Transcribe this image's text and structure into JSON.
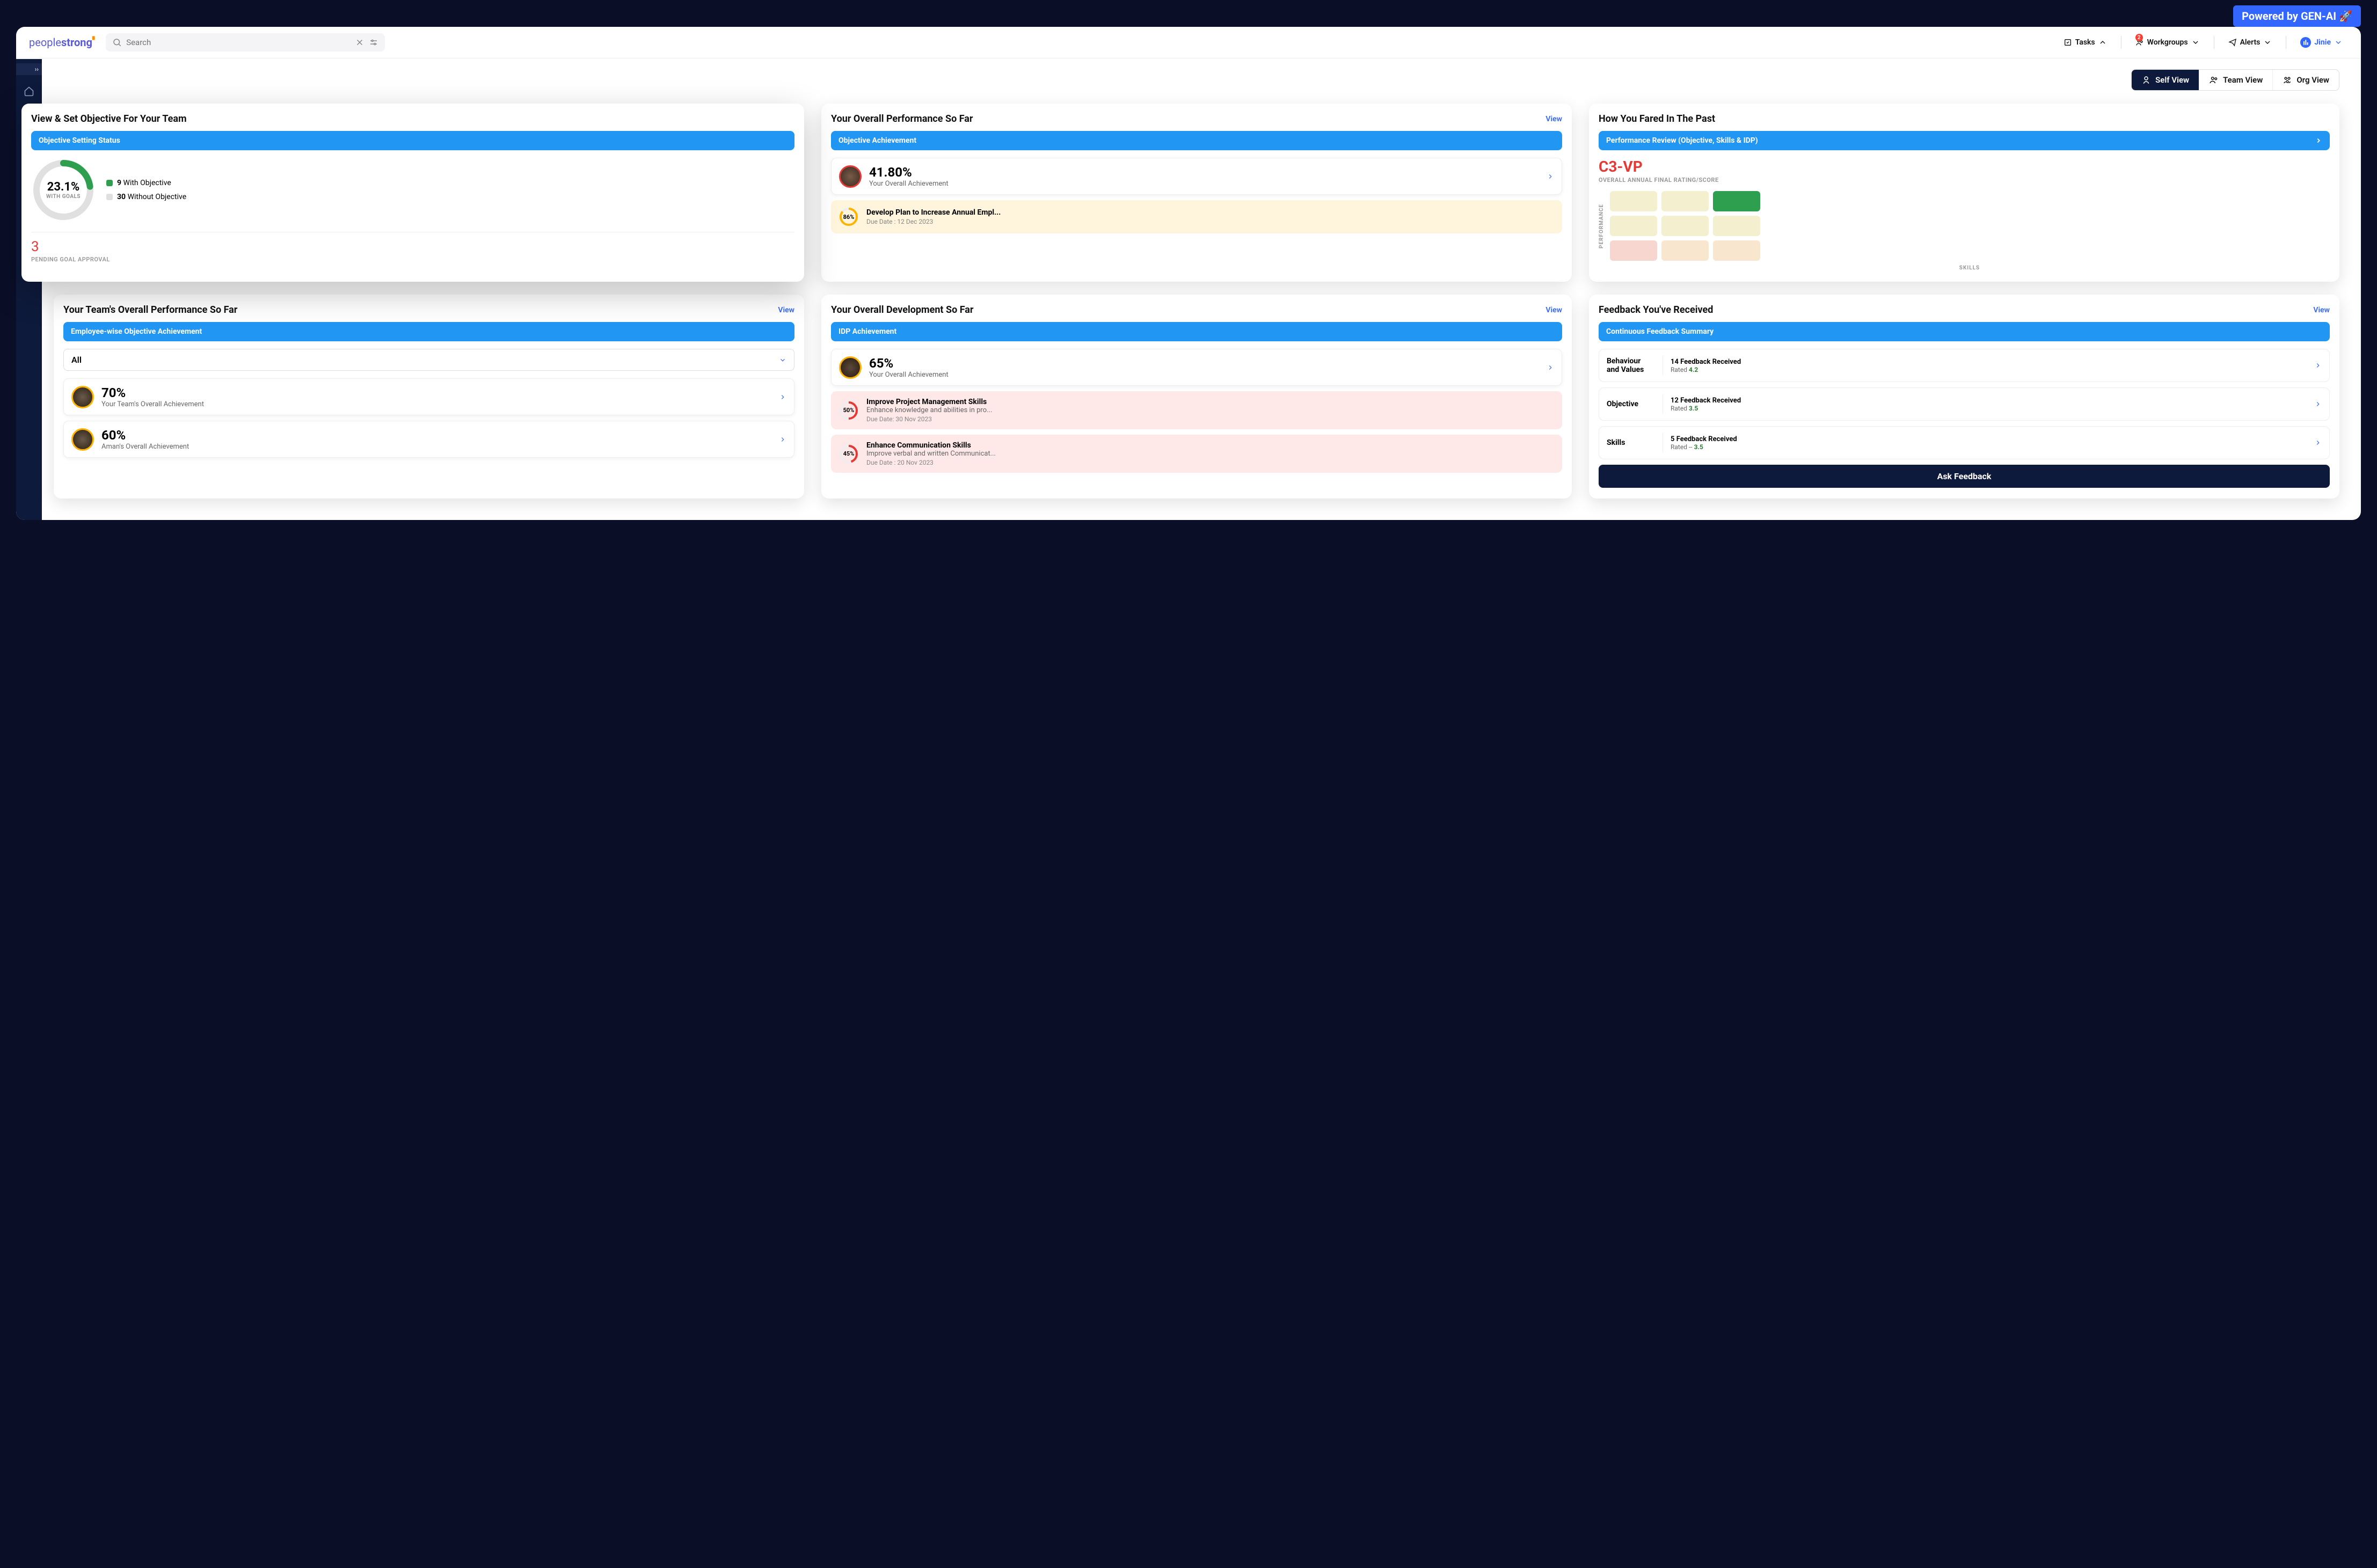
{
  "badge": "Powered by GEN-AI 🚀",
  "logo": {
    "a": "people",
    "b": "strong"
  },
  "search": {
    "placeholder": "Search"
  },
  "topnav": {
    "tasks": "Tasks",
    "workgroups": "Workgroups",
    "workgroups_badge": "2",
    "alerts": "Alerts",
    "user": "Jinie"
  },
  "views": {
    "self": "Self View",
    "team": "Team View",
    "org": "Org View"
  },
  "card_objective": {
    "title": "View & Set Objective For Your Team",
    "subheader": "Objective Setting Status",
    "donut_pct": "23.1%",
    "donut_sub": "WITH GOALS",
    "donut_value": 23.1,
    "legend_with_n": "9",
    "legend_with": "With Objective",
    "legend_without_n": "30",
    "legend_without": "Without Objective",
    "pending_n": "3",
    "pending_label": "PENDING GOAL APPROVAL"
  },
  "card_overall_perf": {
    "title": "Your Overall Performance So Far",
    "view": "View",
    "subheader": "Objective Achievement",
    "pct": "41.80%",
    "sub": "Your Overall Achievement",
    "goal_pct": "86%",
    "goal_pct_val": 86,
    "goal_title": "Develop Plan to Increase Annual Empl...",
    "goal_due": "Due Date : 12 Dec 2023"
  },
  "card_past": {
    "title": "How You Fared In The Past",
    "subheader": "Performance Review (Objective, Skills & IDP)",
    "rating": "C3-VP",
    "rating_sub": "OVERALL ANNUAL FINAL RATING/SCORE",
    "ylabel": "PERFORMANCE",
    "xlabel": "SKILLS",
    "matrix_colors": [
      "#f4efce",
      "#f4efce",
      "#2e9e4f",
      "#f4efce",
      "#f4efce",
      "#f4efce",
      "#f7d6cf",
      "#f9e6cf",
      "#f9e6cf"
    ]
  },
  "card_team_perf": {
    "title": "Your Team's Overall Performance So Far",
    "view": "View",
    "subheader": "Employee-wise Objective Achievement",
    "filter": "All",
    "rows": [
      {
        "pct": "70%",
        "label": "Your Team's Overall Achievement"
      },
      {
        "pct": "60%",
        "label": "Aman's Overall Achievement"
      }
    ]
  },
  "card_dev": {
    "title": "Your Overall Development So Far",
    "view": "View",
    "subheader": "IDP Achievement",
    "pct": "65%",
    "sub": "Your Overall Achievement",
    "goals": [
      {
        "pct": "50%",
        "val": 50,
        "title": "Improve Project Management Skills",
        "desc": "Enhance knowledge and abilities in pro...",
        "due": "Due Date: 30 Nov 2023"
      },
      {
        "pct": "45%",
        "val": 45,
        "title": "Enhance Communication Skills",
        "desc": "Improve verbal and written Communicat...",
        "due": "Due Date : 20 Nov 2023"
      }
    ]
  },
  "card_feedback": {
    "title": "Feedback You've Received",
    "view": "View",
    "subheader": "Continuous Feedback Summary",
    "rows": [
      {
        "label": "Behaviour and Values",
        "count": "14 Feedback Received",
        "rated": "Rated",
        "score": "4.2"
      },
      {
        "label": "Objective",
        "count": "12 Feedback Received",
        "rated": "Rated",
        "score": "3.5"
      },
      {
        "label": "Skills",
        "count": "5 Feedback Received",
        "rated": "Rated --",
        "score": "3.5"
      }
    ],
    "ask": "Ask Feedback"
  },
  "chart_data": {
    "objective_donut": {
      "type": "pie",
      "title": "Objective Setting Status",
      "categories": [
        "With Objective",
        "Without Objective"
      ],
      "values": [
        9,
        30
      ],
      "pct_with_goals": 23.1
    },
    "performance_matrix": {
      "type": "heatmap",
      "xlabel": "SKILLS",
      "ylabel": "PERFORMANCE",
      "rows": 3,
      "cols": 3,
      "highlight_cell": [
        0,
        2
      ]
    }
  }
}
